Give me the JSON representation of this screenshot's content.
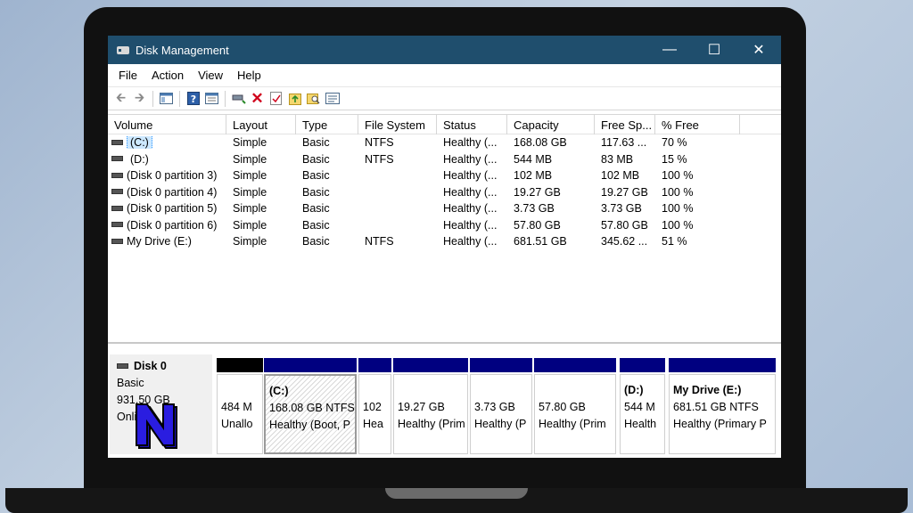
{
  "window": {
    "title": "Disk Management",
    "minimize": "—",
    "maximize": "☐",
    "close": "✕"
  },
  "menu": [
    "File",
    "Action",
    "View",
    "Help"
  ],
  "columns": [
    "Volume",
    "Layout",
    "Type",
    "File System",
    "Status",
    "Capacity",
    "Free Sp...",
    "% Free"
  ],
  "volumes": [
    {
      "volume": "(C:)",
      "layout": "Simple",
      "type": "Basic",
      "fs": "NTFS",
      "status": "Healthy (...",
      "capacity": "168.08 GB",
      "free": "117.63 ...",
      "pct": "70 %"
    },
    {
      "volume": "(D:)",
      "layout": "Simple",
      "type": "Basic",
      "fs": "NTFS",
      "status": "Healthy (...",
      "capacity": "544 MB",
      "free": "83 MB",
      "pct": "15 %"
    },
    {
      "volume": "(Disk 0 partition 3)",
      "layout": "Simple",
      "type": "Basic",
      "fs": "",
      "status": "Healthy (...",
      "capacity": "102 MB",
      "free": "102 MB",
      "pct": "100 %"
    },
    {
      "volume": "(Disk 0 partition 4)",
      "layout": "Simple",
      "type": "Basic",
      "fs": "",
      "status": "Healthy (...",
      "capacity": "19.27 GB",
      "free": "19.27 GB",
      "pct": "100 %"
    },
    {
      "volume": "(Disk 0 partition 5)",
      "layout": "Simple",
      "type": "Basic",
      "fs": "",
      "status": "Healthy (...",
      "capacity": "3.73 GB",
      "free": "3.73 GB",
      "pct": "100 %"
    },
    {
      "volume": "(Disk 0 partition 6)",
      "layout": "Simple",
      "type": "Basic",
      "fs": "",
      "status": "Healthy (...",
      "capacity": "57.80 GB",
      "free": "57.80 GB",
      "pct": "100 %"
    },
    {
      "volume": "My Drive (E:)",
      "layout": "Simple",
      "type": "Basic",
      "fs": "NTFS",
      "status": "Healthy (...",
      "capacity": "681.51 GB",
      "free": "345.62 ...",
      "pct": "51 %"
    }
  ],
  "disk": {
    "name": "Disk 0",
    "type": "Basic",
    "size": "931.50 GB",
    "status": "Online"
  },
  "partitions": [
    {
      "label": "",
      "line1": "484 M",
      "line2": "Unallo"
    },
    {
      "label": "(C:)",
      "line1": "168.08 GB NTFS",
      "line2": "Healthy (Boot, P"
    },
    {
      "label": "",
      "line1": "102",
      "line2": "Hea"
    },
    {
      "label": "",
      "line1": "19.27 GB",
      "line2": "Healthy (Prim"
    },
    {
      "label": "",
      "line1": "3.73 GB",
      "line2": "Healthy (P"
    },
    {
      "label": "",
      "line1": "57.80 GB",
      "line2": "Healthy (Prim"
    },
    {
      "label": "(D:)",
      "line1": "544 M",
      "line2": "Health"
    },
    {
      "label": "My Drive  (E:)",
      "line1": "681.51 GB NTFS",
      "line2": "Healthy (Primary P"
    }
  ],
  "icons": [
    "back-arrow-icon",
    "forward-arrow-icon",
    "console-tree-icon",
    "help-icon",
    "properties-icon",
    "connect-icon",
    "delete-icon",
    "check-icon",
    "folder-up-icon",
    "search-folder-icon",
    "list-icon"
  ],
  "colors": {
    "titlebar": "#1f4e6d",
    "primary_partition": "#000080",
    "unallocated": "#000000"
  }
}
